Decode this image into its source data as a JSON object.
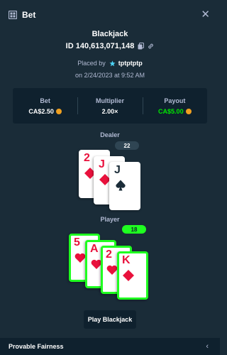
{
  "header": {
    "title": "Bet",
    "icon": "bet-slip-icon",
    "close_icon": "close-icon",
    "close_glyph": "✕"
  },
  "bet": {
    "game_title": "Blackjack",
    "id_label": "ID 140,613,071,148",
    "placed_prefix": "Placed by",
    "username": "tptptptp",
    "date": "on 2/24/2023 at 9:52 AM"
  },
  "stats": {
    "bet_label": "Bet",
    "bet_value": "CA$2.50",
    "multiplier_label": "Multiplier",
    "multiplier_value": "2.00×",
    "payout_label": "Payout",
    "payout_value": "CA$5.00"
  },
  "dealer": {
    "label": "Dealer",
    "score": "22",
    "cards": [
      {
        "rank": "2",
        "suit": "diamond"
      },
      {
        "rank": "J",
        "suit": "diamond"
      },
      {
        "rank": "J",
        "suit": "spade"
      }
    ]
  },
  "player": {
    "label": "Player",
    "score": "18",
    "cards": [
      {
        "rank": "5",
        "suit": "heart"
      },
      {
        "rank": "A",
        "suit": "heart"
      },
      {
        "rank": "2",
        "suit": "heart"
      },
      {
        "rank": "K",
        "suit": "diamond"
      }
    ]
  },
  "actions": {
    "play_label": "Play Blackjack"
  },
  "footer": {
    "title": "Provable Fairness",
    "chevron": "‹"
  },
  "colors": {
    "background": "#1a2c38",
    "panel": "#0f212e",
    "text_muted": "#b1bad3",
    "win_green": "#1fff20",
    "payout_green": "#00e701",
    "card_red": "#e9113c"
  }
}
